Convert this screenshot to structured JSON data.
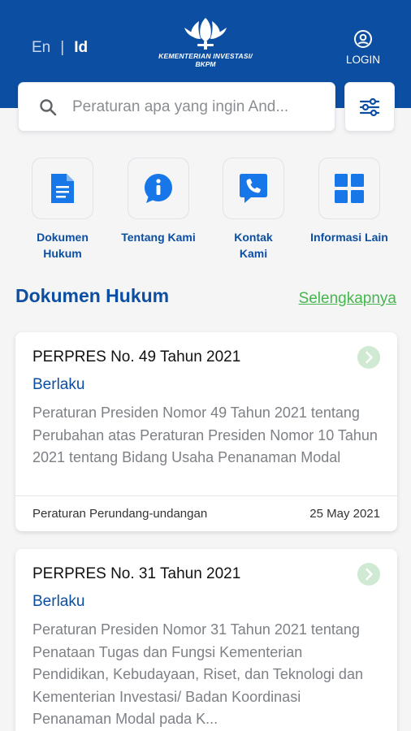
{
  "header": {
    "lang_en": "En",
    "lang_sep": "|",
    "lang_id": "Id",
    "logo_line1": "KEMENTERIAN INVESTASI/",
    "logo_line2": "BKPM",
    "login_label": "LOGIN",
    "login_icon": "user-circle-icon"
  },
  "search": {
    "placeholder": "Peraturan apa yang ingin And...",
    "search_icon": "search-icon",
    "filter_icon": "sliders-icon"
  },
  "menu": [
    {
      "label_line1": "Dokumen",
      "label_line2": "Hukum",
      "icon": "document-icon"
    },
    {
      "label_line1": "Tentang Kami",
      "label_line2": "",
      "icon": "info-icon"
    },
    {
      "label_line1": "Kontak",
      "label_line2": "Kami",
      "icon": "phone-chat-icon"
    },
    {
      "label_line1": "Informasi Lain",
      "label_line2": "",
      "icon": "grid-icon"
    }
  ],
  "section": {
    "title": "Dokumen Hukum",
    "more_link": "Selengkapnya"
  },
  "documents": [
    {
      "title": "PERPRES No. 49 Tahun 2021",
      "status": "Berlaku",
      "description": "Peraturan Presiden Nomor 49 Tahun 2021 tentang Perubahan atas Peraturan Presiden Nomor 10 Tahun 2021 tentang Bidang Usaha Penanaman Modal",
      "category": "Peraturan Perundang-undangan",
      "date": "25 May 2021"
    },
    {
      "title": "PERPRES No. 31 Tahun 2021",
      "status": "Berlaku",
      "description": "Peraturan Presiden Nomor 31 Tahun 2021 tentang Penataan Tugas dan Fungsi Kementerian Pendidikan, Kebudayaan, Riset, dan Teknologi dan Kementerian Investasi/ Badan Koordinasi Penanaman Modal pada K...",
      "category": "",
      "date": ""
    }
  ],
  "colors": {
    "brand_blue": "#0b4ea2",
    "link_green": "#46b64e",
    "chevron_green": "#cfe9d3"
  }
}
